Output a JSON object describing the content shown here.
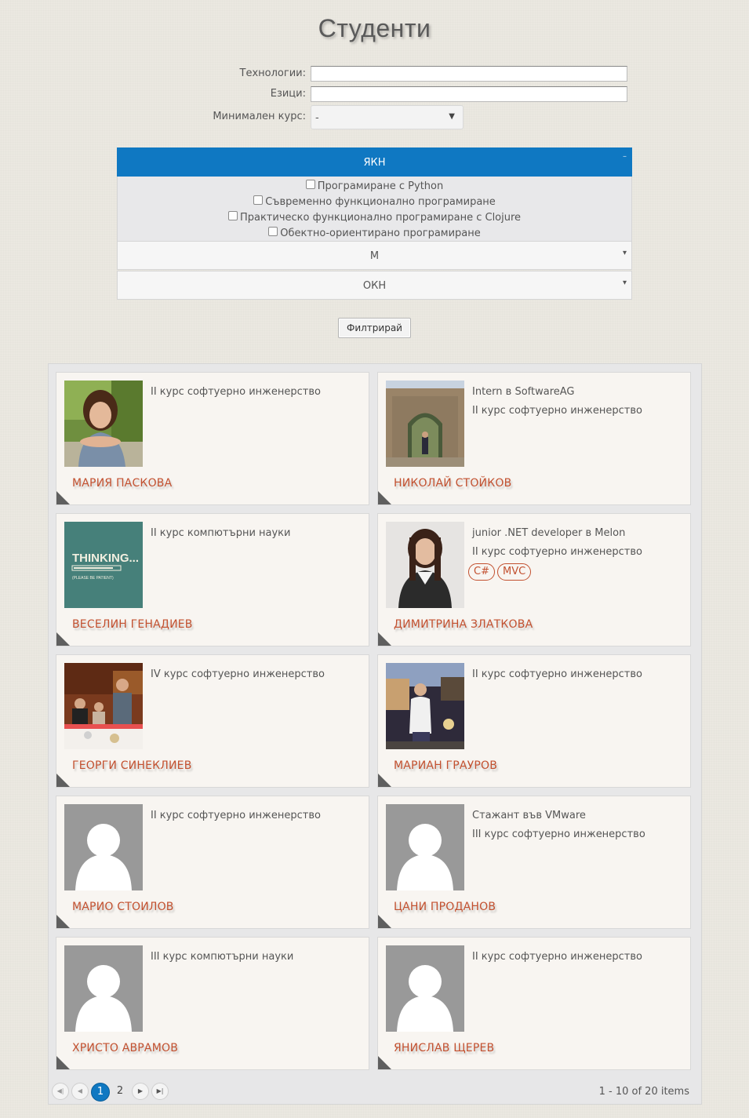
{
  "page": {
    "title": "Студенти"
  },
  "filters": {
    "technologies_label": "Технологии:",
    "technologies_value": "",
    "languages_label": "Езици:",
    "languages_value": "",
    "min_course_label": "Минимален курс:",
    "min_course_value": "-"
  },
  "accordion": {
    "panels": [
      {
        "label": "ЯКН",
        "expanded": true,
        "courses": [
          "Програмиране с Python",
          "Съвременно функционално програмиране",
          "Практическо функционално програмиране с Clojure",
          "Обектно-ориентирано програмиране"
        ]
      },
      {
        "label": "М",
        "expanded": false
      },
      {
        "label": "ОКН",
        "expanded": false
      }
    ]
  },
  "filter_button": "Филтрирай",
  "students": [
    {
      "name": "МАРИЯ ПАСКОВА",
      "lines": [
        "II курс софтуерно инженерство"
      ],
      "tags": [],
      "photo": "portrait-girl-in-park"
    },
    {
      "name": "НИКОЛАЙ СТОЙКОВ",
      "lines": [
        "Intern в SoftwareAG",
        "II курс софтуерно инженерство"
      ],
      "tags": [],
      "photo": "stone-arch"
    },
    {
      "name": "ВЕСЕЛИН ГЕНАДИЕВ",
      "lines": [
        "II курс компютърни науки"
      ],
      "tags": [],
      "photo": "thinking-loading"
    },
    {
      "name": "ДИМИТРИНА ЗЛАТКОВА",
      "lines": [
        "junior .NET developer в Melon",
        "II курс софтуерно инженерство"
      ],
      "tags": [
        "C#",
        "MVC"
      ],
      "photo": "portrait-woman"
    },
    {
      "name": "ГЕОРГИ СИНЕКЛИЕВ",
      "lines": [
        "IV курс софтуерно инженерство"
      ],
      "tags": [],
      "photo": "dinner-group"
    },
    {
      "name": "МАРИАН ГРАУРОВ",
      "lines": [
        "II курс софтуерно инженерство"
      ],
      "tags": [],
      "photo": "evening-street"
    },
    {
      "name": "МАРИО СТОИЛОВ",
      "lines": [
        "II курс софтуерно инженерство"
      ],
      "tags": [],
      "photo": "default-avatar"
    },
    {
      "name": "ЦАНИ ПРОДАНОВ",
      "lines": [
        "Стажант във VMware",
        "III курс софтуерно инженерство"
      ],
      "tags": [],
      "photo": "default-avatar"
    },
    {
      "name": "ХРИСТО АВРАМОВ",
      "lines": [
        "III курс компютърни науки"
      ],
      "tags": [],
      "photo": "default-avatar"
    },
    {
      "name": "ЯНИСЛАВ ЩЕРЕВ",
      "lines": [
        "II курс софтуерно инженерство"
      ],
      "tags": [],
      "photo": "default-avatar"
    }
  ],
  "thinking_image_text": {
    "main": "THINKING...",
    "sub": "(PLEASE BE PATIENT)"
  },
  "pager": {
    "pages": [
      "1",
      "2"
    ],
    "current": "1",
    "info": "1 - 10 of 20 items",
    "icons": [
      "first-page-icon",
      "prev-page-icon",
      "next-page-icon",
      "last-page-icon"
    ]
  },
  "colors": {
    "accent": "#0f78c2",
    "name": "#c2502f",
    "card_bg": "#f8f5f1"
  }
}
